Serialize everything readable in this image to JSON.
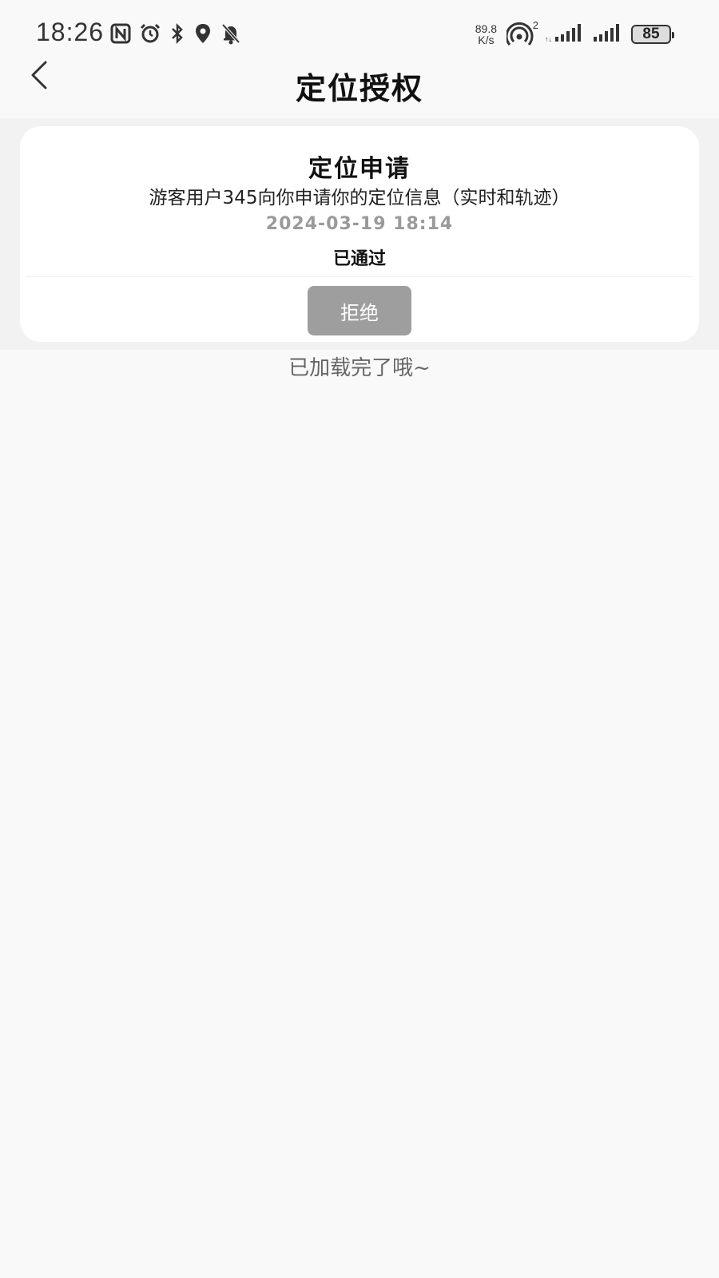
{
  "status_bar": {
    "time": "18:26",
    "net_speed_value": "89.8",
    "net_speed_unit": "K/s",
    "hotspot_badge": "2",
    "battery": "85",
    "icons": [
      "nfc-icon",
      "alarm-icon",
      "bluetooth-icon",
      "location-icon",
      "mute-bell-icon",
      "hotspot-icon",
      "signal-icon",
      "signal-icon"
    ]
  },
  "header": {
    "title": "定位授权",
    "back_icon": "back-arrow-icon"
  },
  "requests": [
    {
      "title": "定位申请",
      "description": "游客用户345向你申请你的定位信息（实时和轨迹）",
      "timestamp": "2024-03-19 18:14",
      "status": "已通过",
      "reject_label": "拒绝"
    }
  ],
  "footer": {
    "load_complete": "已加载完了哦~"
  },
  "colors": {
    "page_background": "#f9f9f9",
    "list_background": "#f2f2f2",
    "card_background": "#ffffff",
    "reject_button": "#9e9e9e",
    "timestamp": "#9a9a9a"
  }
}
